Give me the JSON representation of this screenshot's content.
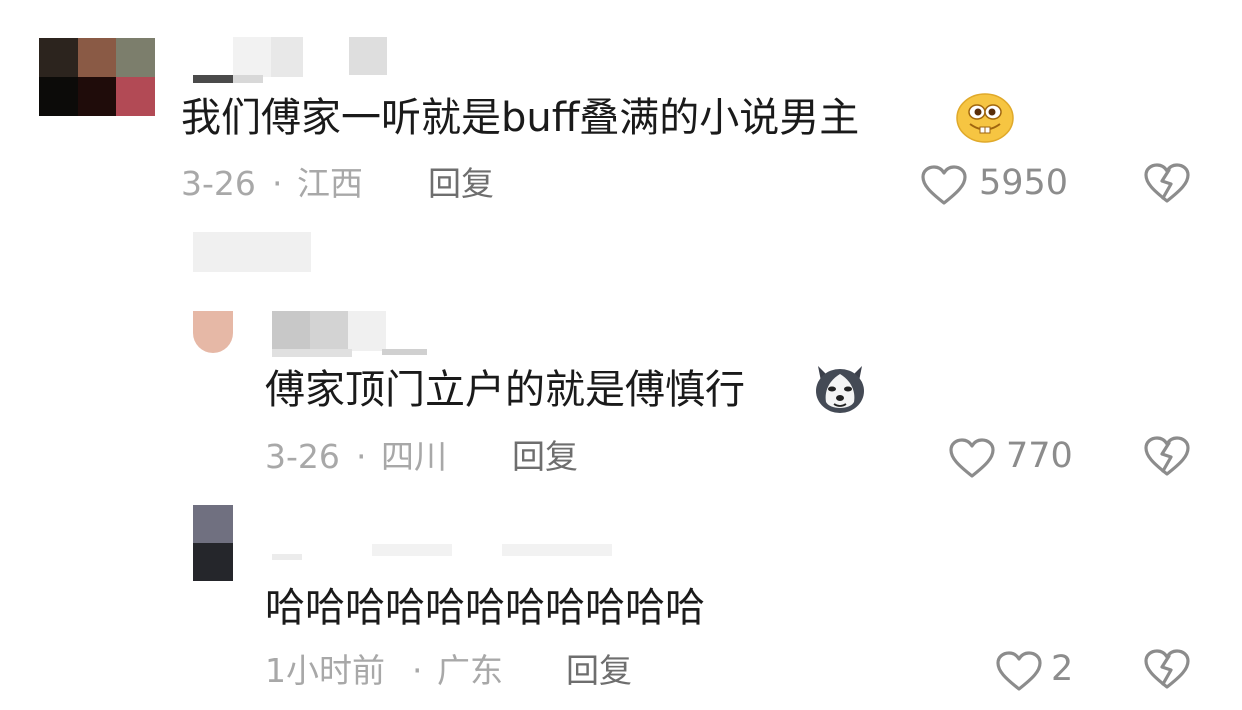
{
  "comments": [
    {
      "text": "我们傅家一听就是buff叠满的小说男主",
      "date": "3-26",
      "separator": "·",
      "location": "江西",
      "reply_label": "回复",
      "likes": "5950",
      "emoji": "smirk-emoji",
      "avatar_colors": [
        "#2c241e",
        "#8a5a45",
        "#7c7e6c",
        "#0c0b09",
        "#1f0c0a",
        "#b24a55"
      ]
    },
    {
      "text": "傅家顶门立户的就是傅慎行",
      "date": "3-26",
      "separator": "·",
      "location": "四川",
      "reply_label": "回复",
      "likes": "770",
      "emoji": "husky-emoji",
      "avatar_colors": [
        "#e6b8a6"
      ]
    },
    {
      "text": "哈哈哈哈哈哈哈哈哈哈哈",
      "date": "1小时前",
      "separator": "·",
      "location": "广东",
      "reply_label": "回复",
      "likes": "2",
      "avatar_colors": [
        "#707080",
        "#25262b"
      ]
    }
  ],
  "colors": {
    "meta_text": "#a8a8a8",
    "reply_text": "#6e6e6e",
    "icon_stroke": "#8c8c8c",
    "censor_light": "#eeeeee",
    "censor_mid": "#dcdcdc"
  }
}
